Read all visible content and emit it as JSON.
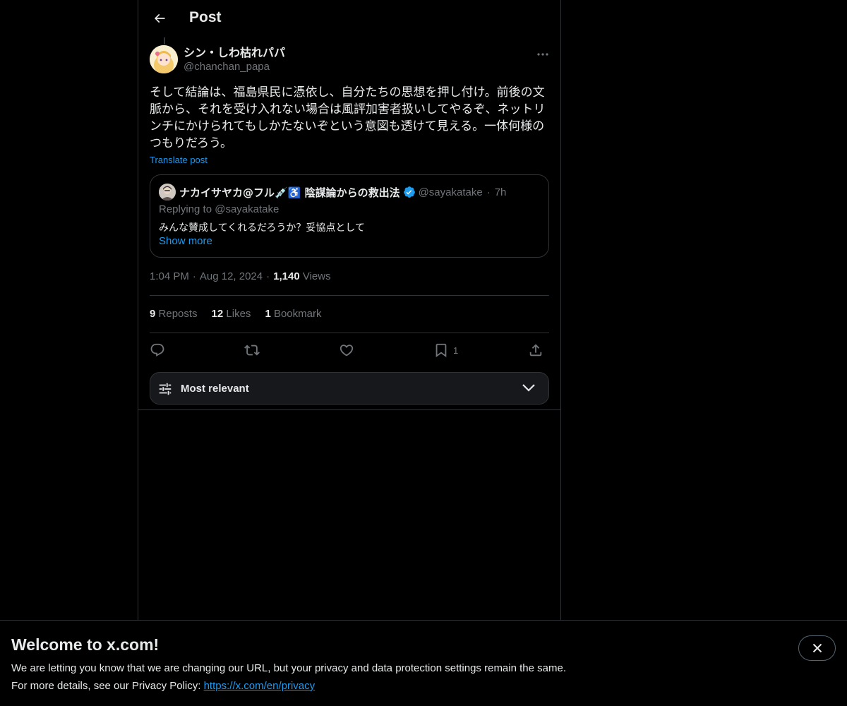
{
  "header": {
    "title": "Post"
  },
  "post": {
    "author_name": "シン・しわ枯れパパ",
    "author_handle": "@chanchan_papa",
    "text": "そして結論は、福島県民に憑依し、自分たちの思想を押し付け。前後の文脈から、それを受け入れない場合は風評加害者扱いしてやるぞ、ネットリンチにかけられてもしかたないぞという意図も透けて見える。一体何様のつもりだろう。",
    "translate_label": "Translate post",
    "time": "1:04 PM",
    "date": "Aug 12, 2024",
    "views_count": "1,140",
    "views_label": "Views"
  },
  "quote": {
    "name": "ナカイサヤカ@フル💉♿️ 陰謀論からの救出法",
    "handle": "@sayakatake",
    "time": "7h",
    "replying_to": "Replying to @sayakatake",
    "text": "みんな賛成してくれるだろうか？妥協点として",
    "show_more": "Show more"
  },
  "stats": {
    "reposts_count": "9",
    "reposts_label": "Reposts",
    "likes_count": "12",
    "likes_label": "Likes",
    "bookmarks_count": "1",
    "bookmarks_label": "Bookmark"
  },
  "actions": {
    "bookmark_count": "1"
  },
  "sort": {
    "label": "Most relevant"
  },
  "banner": {
    "title": "Welcome to x.com!",
    "line1": "We are letting you know that we are changing our URL, but your privacy and data protection settings remain the same.",
    "line2_prefix": "For more details, see our Privacy Policy: ",
    "link": "https://x.com/en/privacy"
  },
  "colors": {
    "accent": "#1d9bf0",
    "background": "#000000",
    "text": "#e7e9ea",
    "muted": "#71767b",
    "border": "#2f3336"
  }
}
